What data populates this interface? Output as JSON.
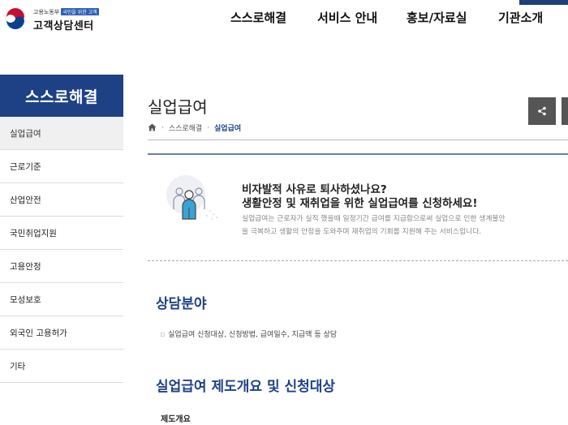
{
  "header": {
    "ministry": "고용노동부",
    "ministry_tag": "국민을 위한 고객",
    "center_name": "고객상담센터",
    "nav": [
      "스스로해결",
      "서비스 안내",
      "홍보/자료실",
      "기관소개"
    ]
  },
  "sidebar": {
    "title": "스스로해결",
    "items": [
      {
        "label": "실업급여"
      },
      {
        "label": "근로기준"
      },
      {
        "label": "산업안전"
      },
      {
        "label": "국민취업지원"
      },
      {
        "label": "고용안정"
      },
      {
        "label": "모성보호"
      },
      {
        "label": "외국인 고용허가"
      },
      {
        "label": "기타"
      }
    ]
  },
  "main": {
    "title": "실업급여",
    "breadcrumb": [
      "스스로해결",
      "실업급여"
    ],
    "intro_heading1": "비자발적 사유로 퇴사하셨나요?",
    "intro_heading2": "생활안정 및 재취업을 위한 실업급여를 신청하세요!",
    "intro_desc1": "실업급여는 근로자가 실직 했을때 일정기간 급여를 지급함으로써 실업으로 인한 생계불안",
    "intro_desc2": "을 극복하고 생활의 안정을 도와주며 재취업의 기회를 지원해 주는 서비스입니다.",
    "section1_title": "상담분야",
    "section1_bullet": "실업급여 신청대상, 신청방법, 급여일수, 지급액 등 상담",
    "section2_title": "실업급여 제도개요 및 신청대상",
    "sub_label": "제도개요"
  },
  "icons": {
    "home": "home-icon",
    "share": "share-icon"
  },
  "colors": {
    "brand_navy": "#1e4186",
    "emblem_red": "#c8102e",
    "emblem_blue": "#0b3f8f"
  }
}
